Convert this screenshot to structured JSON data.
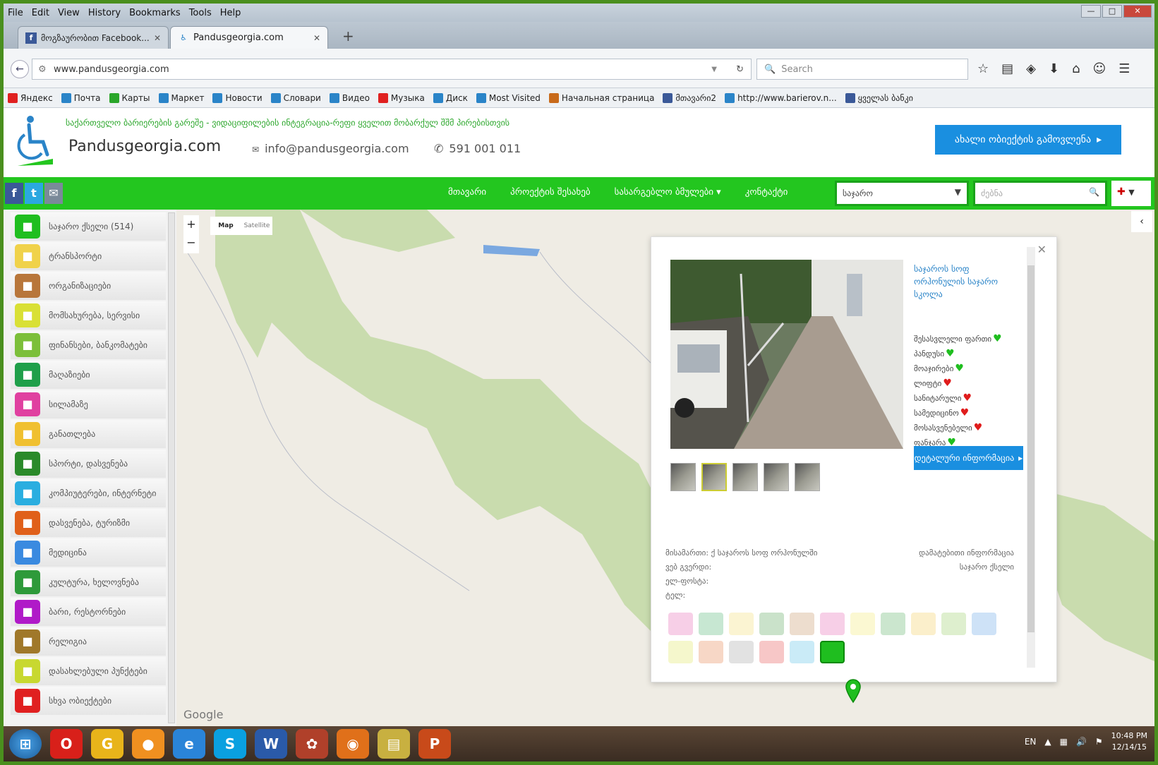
{
  "browser": {
    "menu": [
      "File",
      "Edit",
      "View",
      "History",
      "Bookmarks",
      "Tools",
      "Help"
    ],
    "tabs": [
      {
        "label": "მოგზაურობით Facebook...",
        "active": false
      },
      {
        "label": "Pandusgeorgia.com",
        "active": true
      }
    ],
    "url": "www.pandusgeorgia.com",
    "search_placeholder": "Search",
    "bookmarks": [
      {
        "label": "Яндекс",
        "color": "#e02020"
      },
      {
        "label": "Почта",
        "color": "#2a84c8"
      },
      {
        "label": "Карты",
        "color": "#2aa62a"
      },
      {
        "label": "Маркет",
        "color": "#2a84c8"
      },
      {
        "label": "Новости",
        "color": "#2a84c8"
      },
      {
        "label": "Словари",
        "color": "#2a84c8"
      },
      {
        "label": "Видео",
        "color": "#2a84c8"
      },
      {
        "label": "Музыка",
        "color": "#e02020"
      },
      {
        "label": "Диск",
        "color": "#2a84c8"
      },
      {
        "label": "Most Visited",
        "color": "#2a84c8"
      },
      {
        "label": "Начальная страница",
        "color": "#c86a1a"
      },
      {
        "label": "მთავარი2",
        "color": "#3b5998"
      },
      {
        "label": "http://www.barierov.n...",
        "color": "#2a84c8"
      },
      {
        "label": "ყველას ბანკი",
        "color": "#3b5998"
      }
    ]
  },
  "site": {
    "tagline": "საქართველო ბარიერების გარეშე - ვიდაციფილების ინტეგრაცია-რეფი ყველით მობარქულ შშმ პირებისთვის",
    "brand": "Pandusgeorgia.com",
    "email": "info@pandusgeorgia.com",
    "phone": "591 001 011",
    "add_button": "ახალი ობიექტის გამოვლენა",
    "nav": [
      "მთავარი",
      "პროექტის შესახებ",
      "სასარგებლო ბმულები",
      "კონტაქტი"
    ],
    "region_select": "საჯარო",
    "search_placeholder": "ძებნა"
  },
  "map": {
    "map_type": [
      "Map",
      "Satellite"
    ],
    "google_label": "Google",
    "categories": [
      {
        "label": "საჯარო ქსელი (514)",
        "color": "#1fbe1f",
        "icon": "square-icon"
      },
      {
        "label": "ტრანსპორტი",
        "color": "#f0d24a",
        "icon": "bus-icon"
      },
      {
        "label": "ორგანიზაციები",
        "color": "#b8763a",
        "icon": "building-icon"
      },
      {
        "label": "მომსახურება, სერვისი",
        "color": "#d9e035",
        "icon": "tools-icon"
      },
      {
        "label": "ფინანსები, ბანკომატები",
        "color": "#7cbf3a",
        "icon": "dollar-icon"
      },
      {
        "label": "მაღაზიები",
        "color": "#1f9f4a",
        "icon": "cart-icon"
      },
      {
        "label": "სილამაზე",
        "color": "#e040a0",
        "icon": "beauty-icon"
      },
      {
        "label": "განათლება",
        "color": "#f0c030",
        "icon": "education-icon"
      },
      {
        "label": "სპორტი, დასვენება",
        "color": "#2a8a2a",
        "icon": "ball-icon"
      },
      {
        "label": "კომპიუტერები, ინტერნეტი",
        "color": "#2aaee0",
        "icon": "monitor-icon"
      },
      {
        "label": "დასვენება, ტურიზმი",
        "color": "#e0601a",
        "icon": "hotel-icon"
      },
      {
        "label": "მედიცინა",
        "color": "#3a8ae0",
        "icon": "medical-icon"
      },
      {
        "label": "კულტურა, ხელოვნება",
        "color": "#2e9a3a",
        "icon": "theater-icon"
      },
      {
        "label": "ბარი, რესტორნები",
        "color": "#b01ac8",
        "icon": "cocktail-icon"
      },
      {
        "label": "რელიგია",
        "color": "#a0782a",
        "icon": "religion-icon"
      },
      {
        "label": "დასახლებული პუნქტები",
        "color": "#c8d830",
        "icon": "town-icon"
      },
      {
        "label": "სხვა ობიექტები",
        "color": "#e02020",
        "icon": "other-icon"
      }
    ],
    "popup": {
      "title": "საჯაროს სოფ ორჰონულის საჯარო სკოლა",
      "features": [
        {
          "label": "შესასვლელი ფართი",
          "ok": true
        },
        {
          "label": "პანდუსი",
          "ok": true
        },
        {
          "label": "მოაჯირები",
          "ok": true
        },
        {
          "label": "ლიფტი",
          "ok": false
        },
        {
          "label": "სანიტარული",
          "ok": false
        },
        {
          "label": "სამედიცინო",
          "ok": false
        },
        {
          "label": "მოსასვენებელი",
          "ok": false
        },
        {
          "label": "ფანჯარა",
          "ok": true
        }
      ],
      "full_button": "დეტალური ინფორმაცია",
      "meta_left": [
        "მისამართი: ქ საჯაროს სოფ ორჰონულში",
        "ვებ გვერდი:",
        "ელ-ფოსტა:",
        "ტელ:"
      ],
      "meta_right": [
        "დამატებითი ინფორმაცია",
        "საჯარო ქსელი"
      ],
      "category_colors": [
        "#e040a0",
        "#1f9f4a",
        "#f0d24a",
        "#2a8a2a",
        "#b8763a",
        "#e040a0",
        "#f0e24a",
        "#2e9a3a",
        "#f0c030",
        "#7cbf3a",
        "#3a8ae0",
        "#d9e035",
        "#e0601a",
        "#8a8a8a",
        "#e02020",
        "#2aaee0",
        "#1fbe1f"
      ],
      "active_category": 16
    }
  },
  "taskbar": {
    "apps": [
      {
        "label": "O",
        "color": "#d8201a",
        "icon": "opera-icon"
      },
      {
        "label": "G",
        "color": "#e8b41a",
        "icon": "chrome-icon"
      },
      {
        "label": "●",
        "color": "#f09020",
        "icon": "orb-icon"
      },
      {
        "label": "e",
        "color": "#2a84d8",
        "icon": "ie-icon"
      },
      {
        "label": "S",
        "color": "#0aa0e0",
        "icon": "skype-icon"
      },
      {
        "label": "W",
        "color": "#2a5aa8",
        "icon": "word-icon"
      },
      {
        "label": "✿",
        "color": "#b0402a",
        "icon": "paint-icon"
      },
      {
        "label": "◉",
        "color": "#e0701a",
        "icon": "firefox-icon"
      },
      {
        "label": "▤",
        "color": "#c8b040",
        "icon": "folder-icon"
      },
      {
        "label": "P",
        "color": "#c84a1a",
        "icon": "powerpoint-icon"
      }
    ],
    "lang": "EN",
    "time": "10:48 PM",
    "date": "12/14/15"
  }
}
